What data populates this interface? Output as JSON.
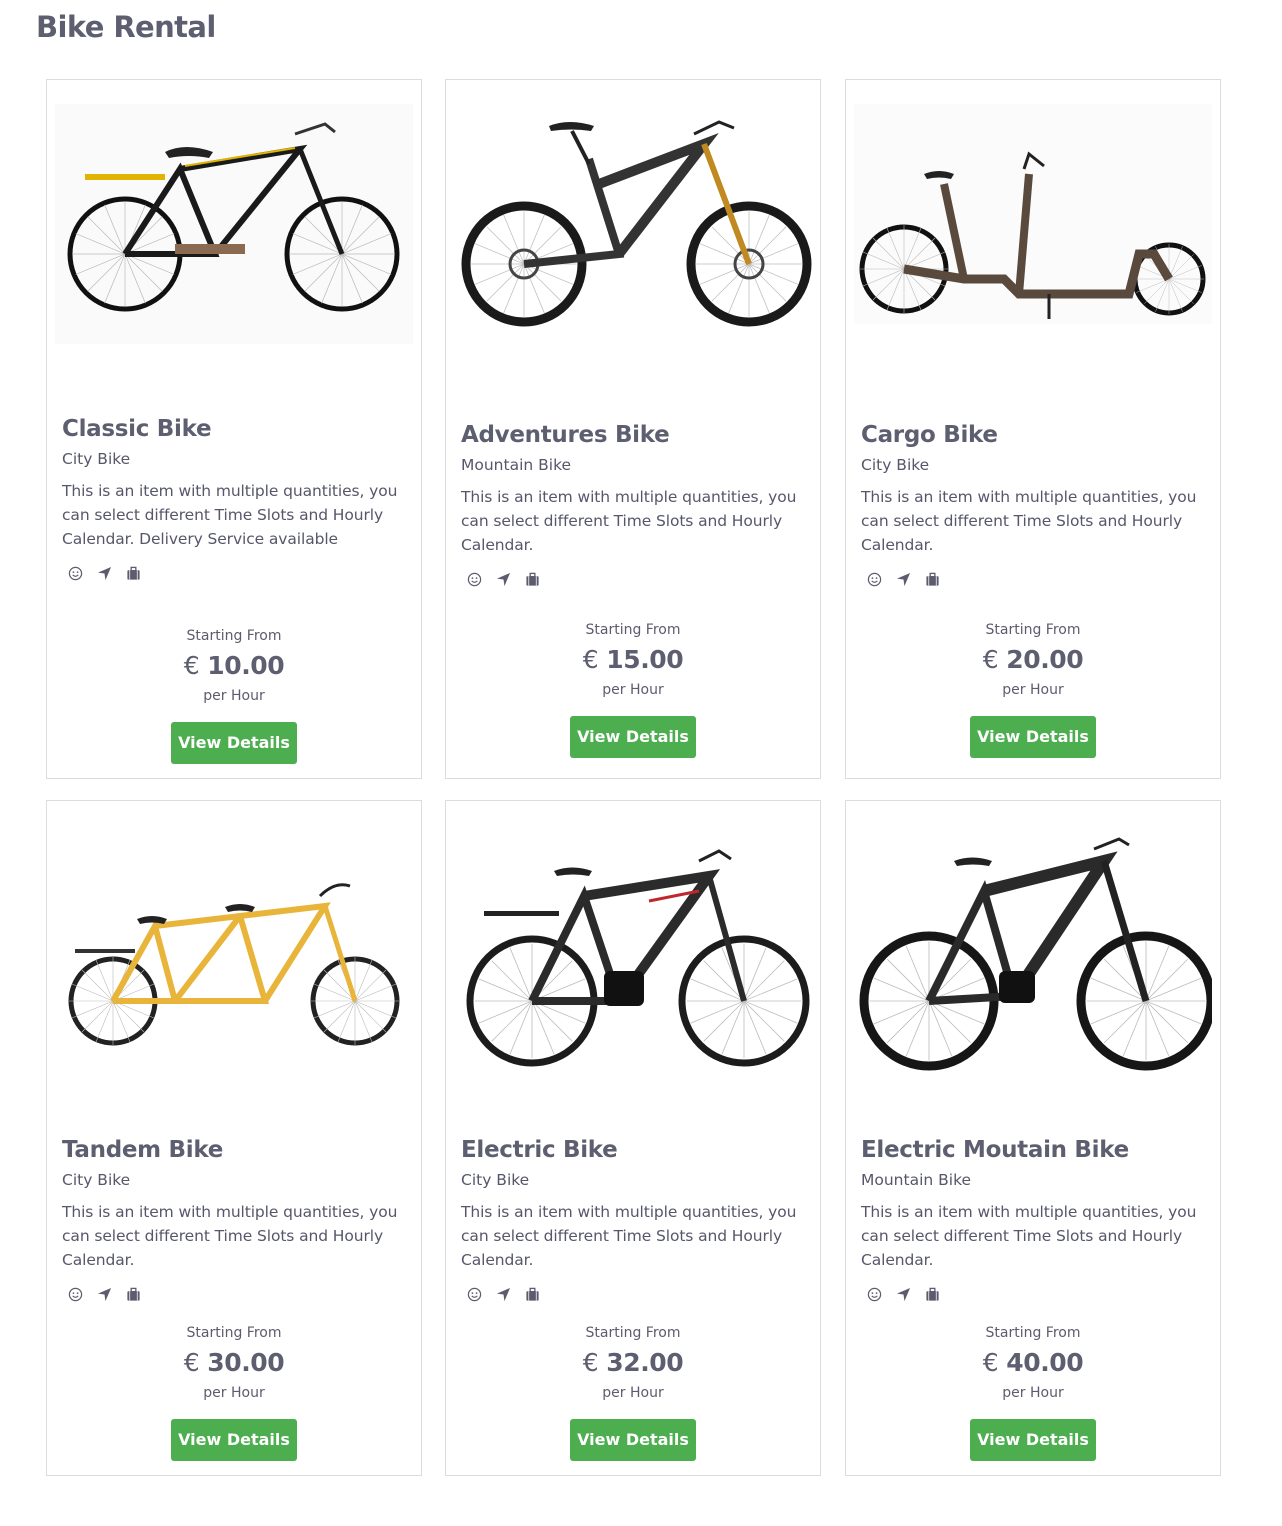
{
  "page": {
    "title": "Bike Rental"
  },
  "icons": [
    "smiley-icon",
    "location-arrow-icon",
    "briefcase-icon"
  ],
  "colors": {
    "button": "#4cae4f",
    "text": "#5d5e70",
    "border": "#dcdcdc"
  },
  "items": [
    {
      "name": "Classic Bike",
      "type": "City Bike",
      "description": "This is an item with multiple quantities, you can select different Time Slots and Hourly Calendar. Delivery Service available",
      "starting_label": "Starting From",
      "currency": "€",
      "price": "10.00",
      "unit": "per Hour",
      "button": "View Details",
      "image": "classic-bike-photo"
    },
    {
      "name": "Adventures Bike",
      "type": "Mountain Bike",
      "description": "This is an item with multiple quantities, you can select different Time Slots and Hourly Calendar.",
      "starting_label": "Starting From",
      "currency": "€",
      "price": "15.00",
      "unit": "per Hour",
      "button": "View Details",
      "image": "mountain-bike-photo"
    },
    {
      "name": "Cargo Bike",
      "type": "City Bike",
      "description": "This is an item with multiple quantities, you can select different Time Slots and Hourly Calendar.",
      "starting_label": "Starting From",
      "currency": "€",
      "price": "20.00",
      "unit": "per Hour",
      "button": "View Details",
      "image": "cargo-bike-photo"
    },
    {
      "name": "Tandem Bike",
      "type": "City Bike",
      "description": "This is an item with multiple quantities, you can select different Time Slots and Hourly Calendar.",
      "starting_label": "Starting From",
      "currency": "€",
      "price": "30.00",
      "unit": "per Hour",
      "button": "View Details",
      "image": "tandem-bike-photo"
    },
    {
      "name": "Electric Bike",
      "type": "City Bike",
      "description": "This is an item with multiple quantities, you can select different Time Slots and Hourly Calendar.",
      "starting_label": "Starting From",
      "currency": "€",
      "price": "32.00",
      "unit": "per Hour",
      "button": "View Details",
      "image": "electric-bike-photo"
    },
    {
      "name": "Electric Moutain Bike",
      "type": "Mountain Bike",
      "description": "This is an item with multiple quantities, you can select different Time Slots and Hourly Calendar.",
      "starting_label": "Starting From",
      "currency": "€",
      "price": "40.00",
      "unit": "per Hour",
      "button": "View Details",
      "image": "electric-mountain-bike-photo"
    }
  ]
}
